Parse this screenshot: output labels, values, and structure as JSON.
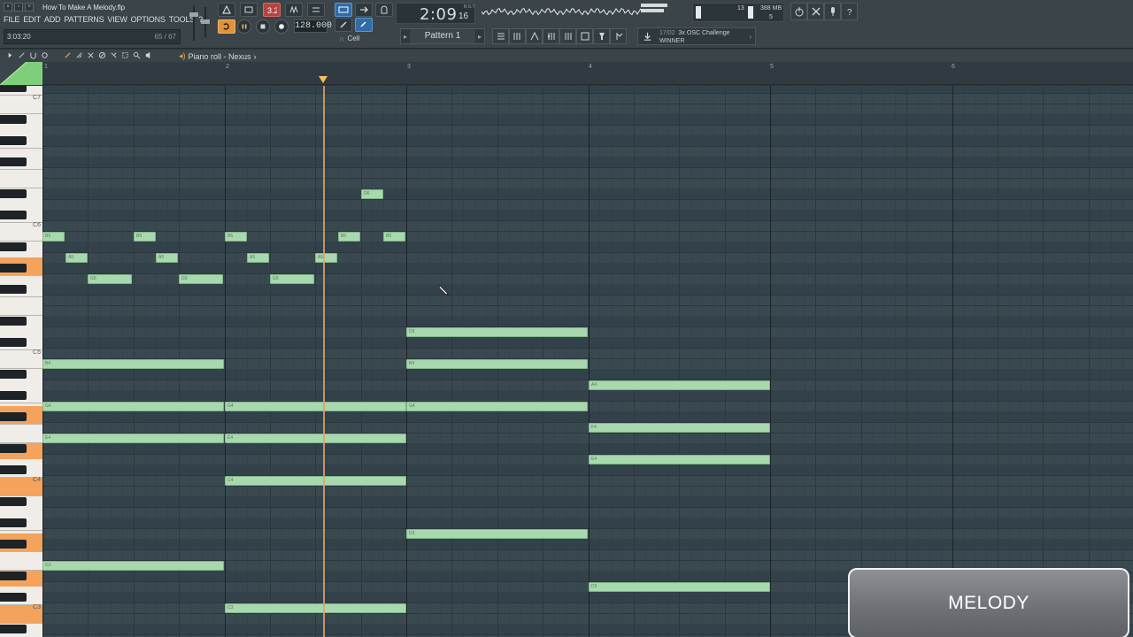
{
  "window": {
    "file_title": "How To Make A Melody.flp"
  },
  "menu": [
    "FILE",
    "EDIT",
    "ADD",
    "PATTERNS",
    "VIEW",
    "OPTIONS",
    "TOOLS",
    "?"
  ],
  "hint_bar": {
    "time": "3:03:20",
    "count": "65 / 67"
  },
  "transport": {
    "tempo": "128.000",
    "time_main": "2:09",
    "time_sub": "16",
    "time_unit": "B:S:T"
  },
  "cpu": {
    "value": "13",
    "memory": "388 MB",
    "memory_sub": "5"
  },
  "snap": {
    "value": "Cell"
  },
  "pattern": {
    "label": "Pattern 1"
  },
  "news": {
    "date": "17/02",
    "title": "3x OSC Challenge",
    "subtitle": "WINNER"
  },
  "piano_roll": {
    "title": "Piano roll - Nexus",
    "arrow": "›"
  },
  "ruler": {
    "bars": [
      "1",
      "2",
      "3",
      "4",
      "5",
      "6"
    ]
  },
  "keyboard": {
    "labels": [
      "C7",
      "C6",
      "C5",
      "C4",
      "C3"
    ]
  },
  "notes": [
    {
      "label": "D6"
    },
    {
      "label": "B5"
    },
    {
      "label": "B5"
    },
    {
      "label": "B5"
    },
    {
      "label": "B5"
    },
    {
      "label": "B5"
    },
    {
      "label": "A5"
    },
    {
      "label": "A5"
    },
    {
      "label": "A5"
    },
    {
      "label": "A5"
    },
    {
      "label": "G5"
    },
    {
      "label": "G5"
    },
    {
      "label": "G5"
    },
    {
      "label": "D5"
    },
    {
      "label": "B4"
    },
    {
      "label": "B4"
    },
    {
      "label": "A4"
    },
    {
      "label": "G4"
    },
    {
      "label": "G4"
    },
    {
      "label": "G4"
    },
    {
      "label": "F4"
    },
    {
      "label": "E4"
    },
    {
      "label": "E4"
    },
    {
      "label": "E4"
    },
    {
      "label": "C4"
    },
    {
      "label": "D3"
    },
    {
      "label": "G3"
    },
    {
      "label": "D3"
    },
    {
      "label": "C3"
    }
  ],
  "overlay": {
    "label": "MELODY"
  },
  "colors": {
    "note_fill": "#a8d8ae",
    "playhead": "#e0a06a",
    "highlight_key": "#f3a35b"
  }
}
